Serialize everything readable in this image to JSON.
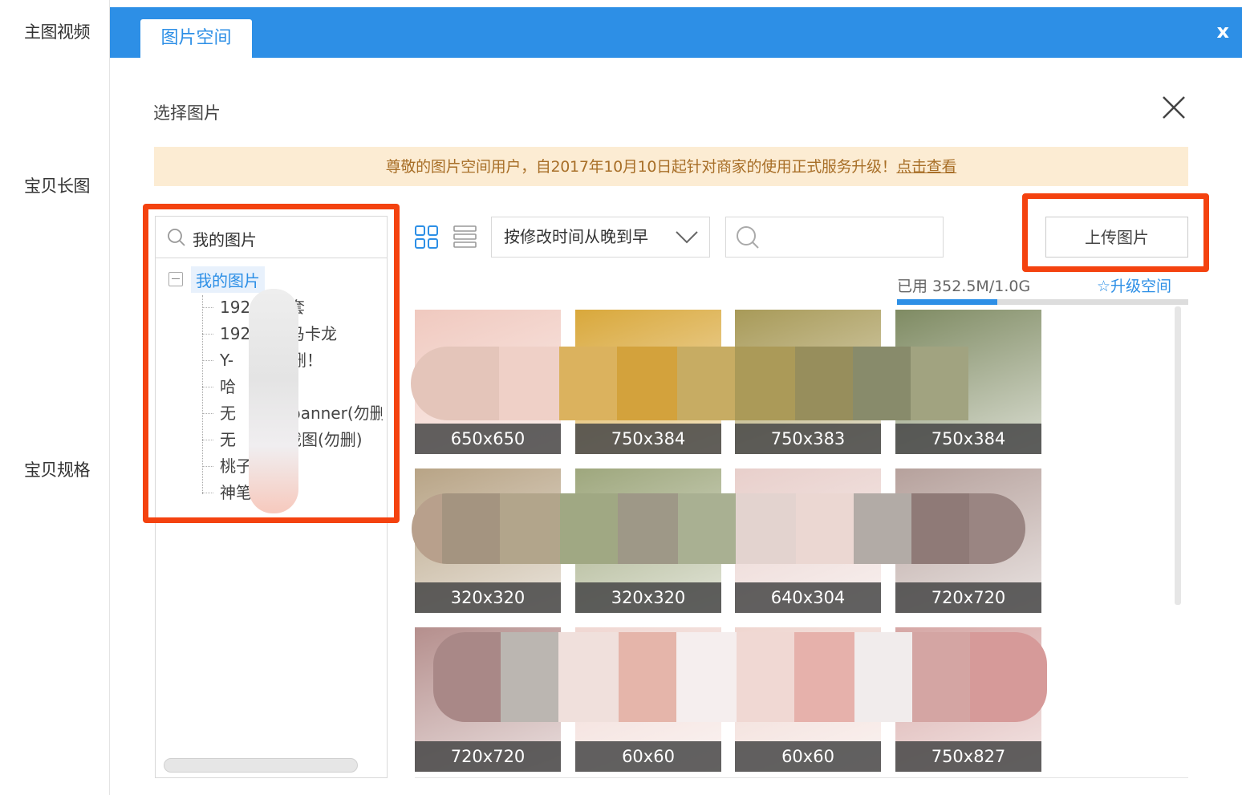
{
  "sidebar": {
    "items": [
      "主图视频",
      "宝贝长图",
      "宝贝规格"
    ]
  },
  "topbar": {
    "tab": "图片空间",
    "close": "x"
  },
  "dialog": {
    "title": "选择图片",
    "notice_text": "尊敬的图片空间用户，自2017年10月10日起针对商家的使用正式服务升级！",
    "notice_link": "点击查看"
  },
  "tree": {
    "search_label": "我的图片",
    "root": "我的图片",
    "items": [
      "192",
      "192",
      "Y-",
      "哈",
      "无",
      "无",
      "桃子",
      "神笔"
    ],
    "item_suffixes": [
      "套",
      "马卡龙",
      "删！",
      "",
      "banner(勿删",
      "截图(勿删)",
      "",
      ""
    ]
  },
  "toolbar": {
    "sort_label": "按修改时间从晚到早",
    "search_placeholder": "",
    "upload": "上传图片"
  },
  "storage": {
    "used_label": "已用 352.5M/1.0G",
    "used_fraction": 0.344,
    "upgrade": "升级空间"
  },
  "images": [
    {
      "size": "650x650",
      "color": "#f0c9bf"
    },
    {
      "size": "750x384",
      "color": "#d9a83b"
    },
    {
      "size": "750x383",
      "color": "#a89a58"
    },
    {
      "size": "750x384",
      "color": "#7f8b63"
    },
    {
      "size": "320x320",
      "color": "#b8a486"
    },
    {
      "size": "320x320",
      "color": "#9ea77d"
    },
    {
      "size": "640x304",
      "color": "#e8cfcb"
    },
    {
      "size": "720x720",
      "color": "#b6a19c"
    },
    {
      "size": "720x720",
      "color": "#b58f8d"
    },
    {
      "size": "60x60",
      "color": "#f0d7d2"
    },
    {
      "size": "60x60",
      "color": "#efd6d0"
    },
    {
      "size": "750x827",
      "color": "#d6a7a5"
    }
  ],
  "colors": {
    "accent": "#2d8fe6",
    "annotation": "#f4420f",
    "notice_bg": "#fcecd3"
  }
}
